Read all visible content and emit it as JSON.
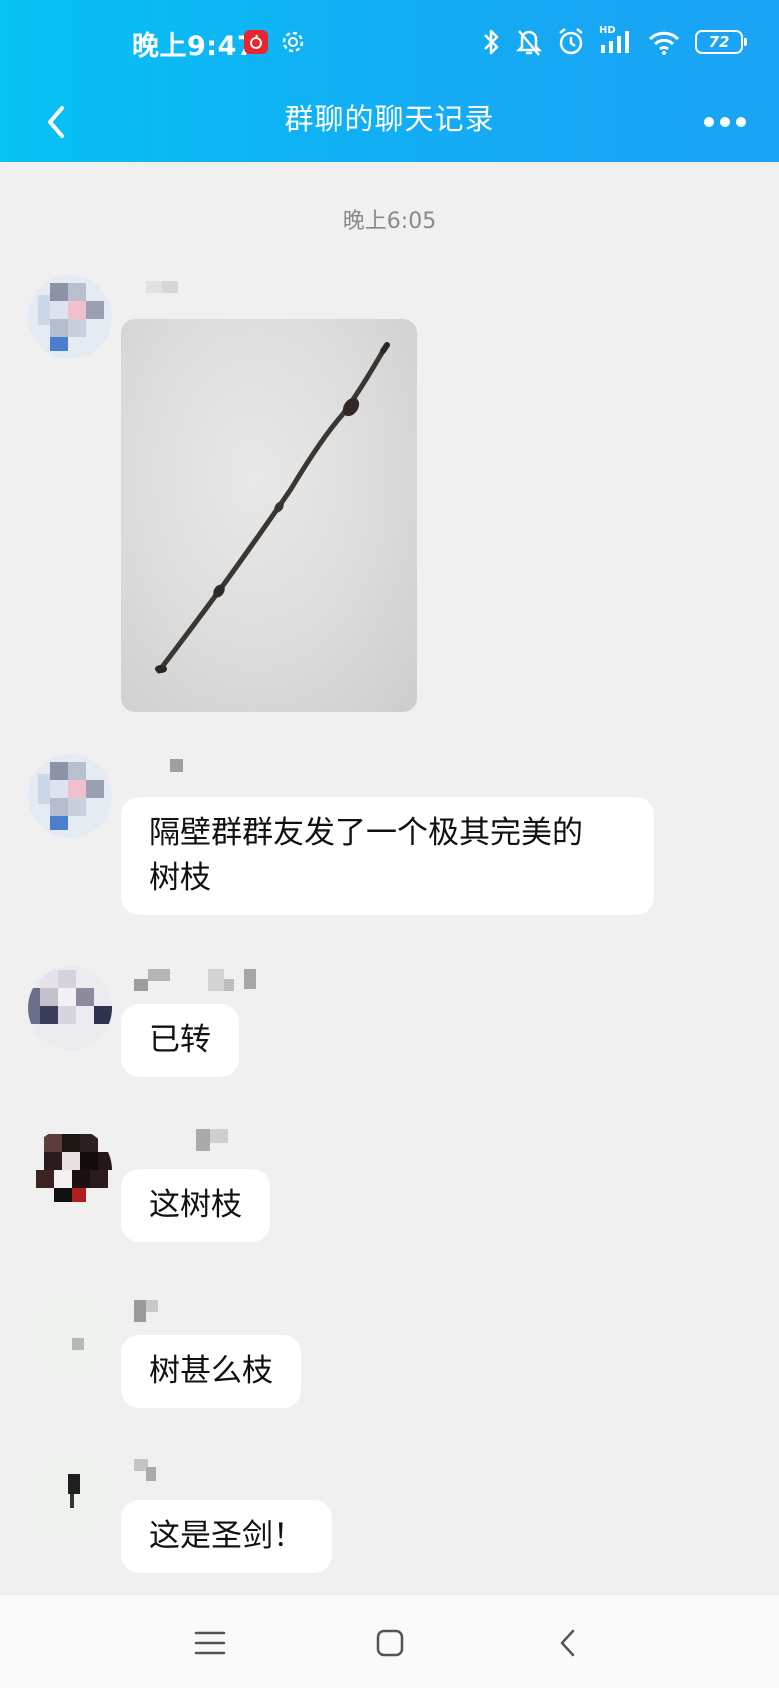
{
  "status_bar": {
    "time": "晚上9:47",
    "network_label": "HD",
    "battery": "72"
  },
  "header": {
    "title": "群聊的聊天记录"
  },
  "chat": {
    "timestamp": "晚上6:05",
    "messages": [
      {
        "type": "image",
        "description_icon": "branch-photo"
      },
      {
        "type": "text",
        "text_line1": "隔壁群群友发了一个极其完美的",
        "text_line2": "树枝"
      },
      {
        "type": "text",
        "text": "已转"
      },
      {
        "type": "text",
        "text": "这树枝"
      },
      {
        "type": "text",
        "text": "树甚么枝"
      },
      {
        "type": "text",
        "text": "这是圣剑！"
      }
    ]
  },
  "colors": {
    "header_gradient_start": "#07c2f3",
    "header_gradient_end": "#1ba3f5",
    "chat_background": "#f0f0f0",
    "bubble": "#ffffff"
  }
}
